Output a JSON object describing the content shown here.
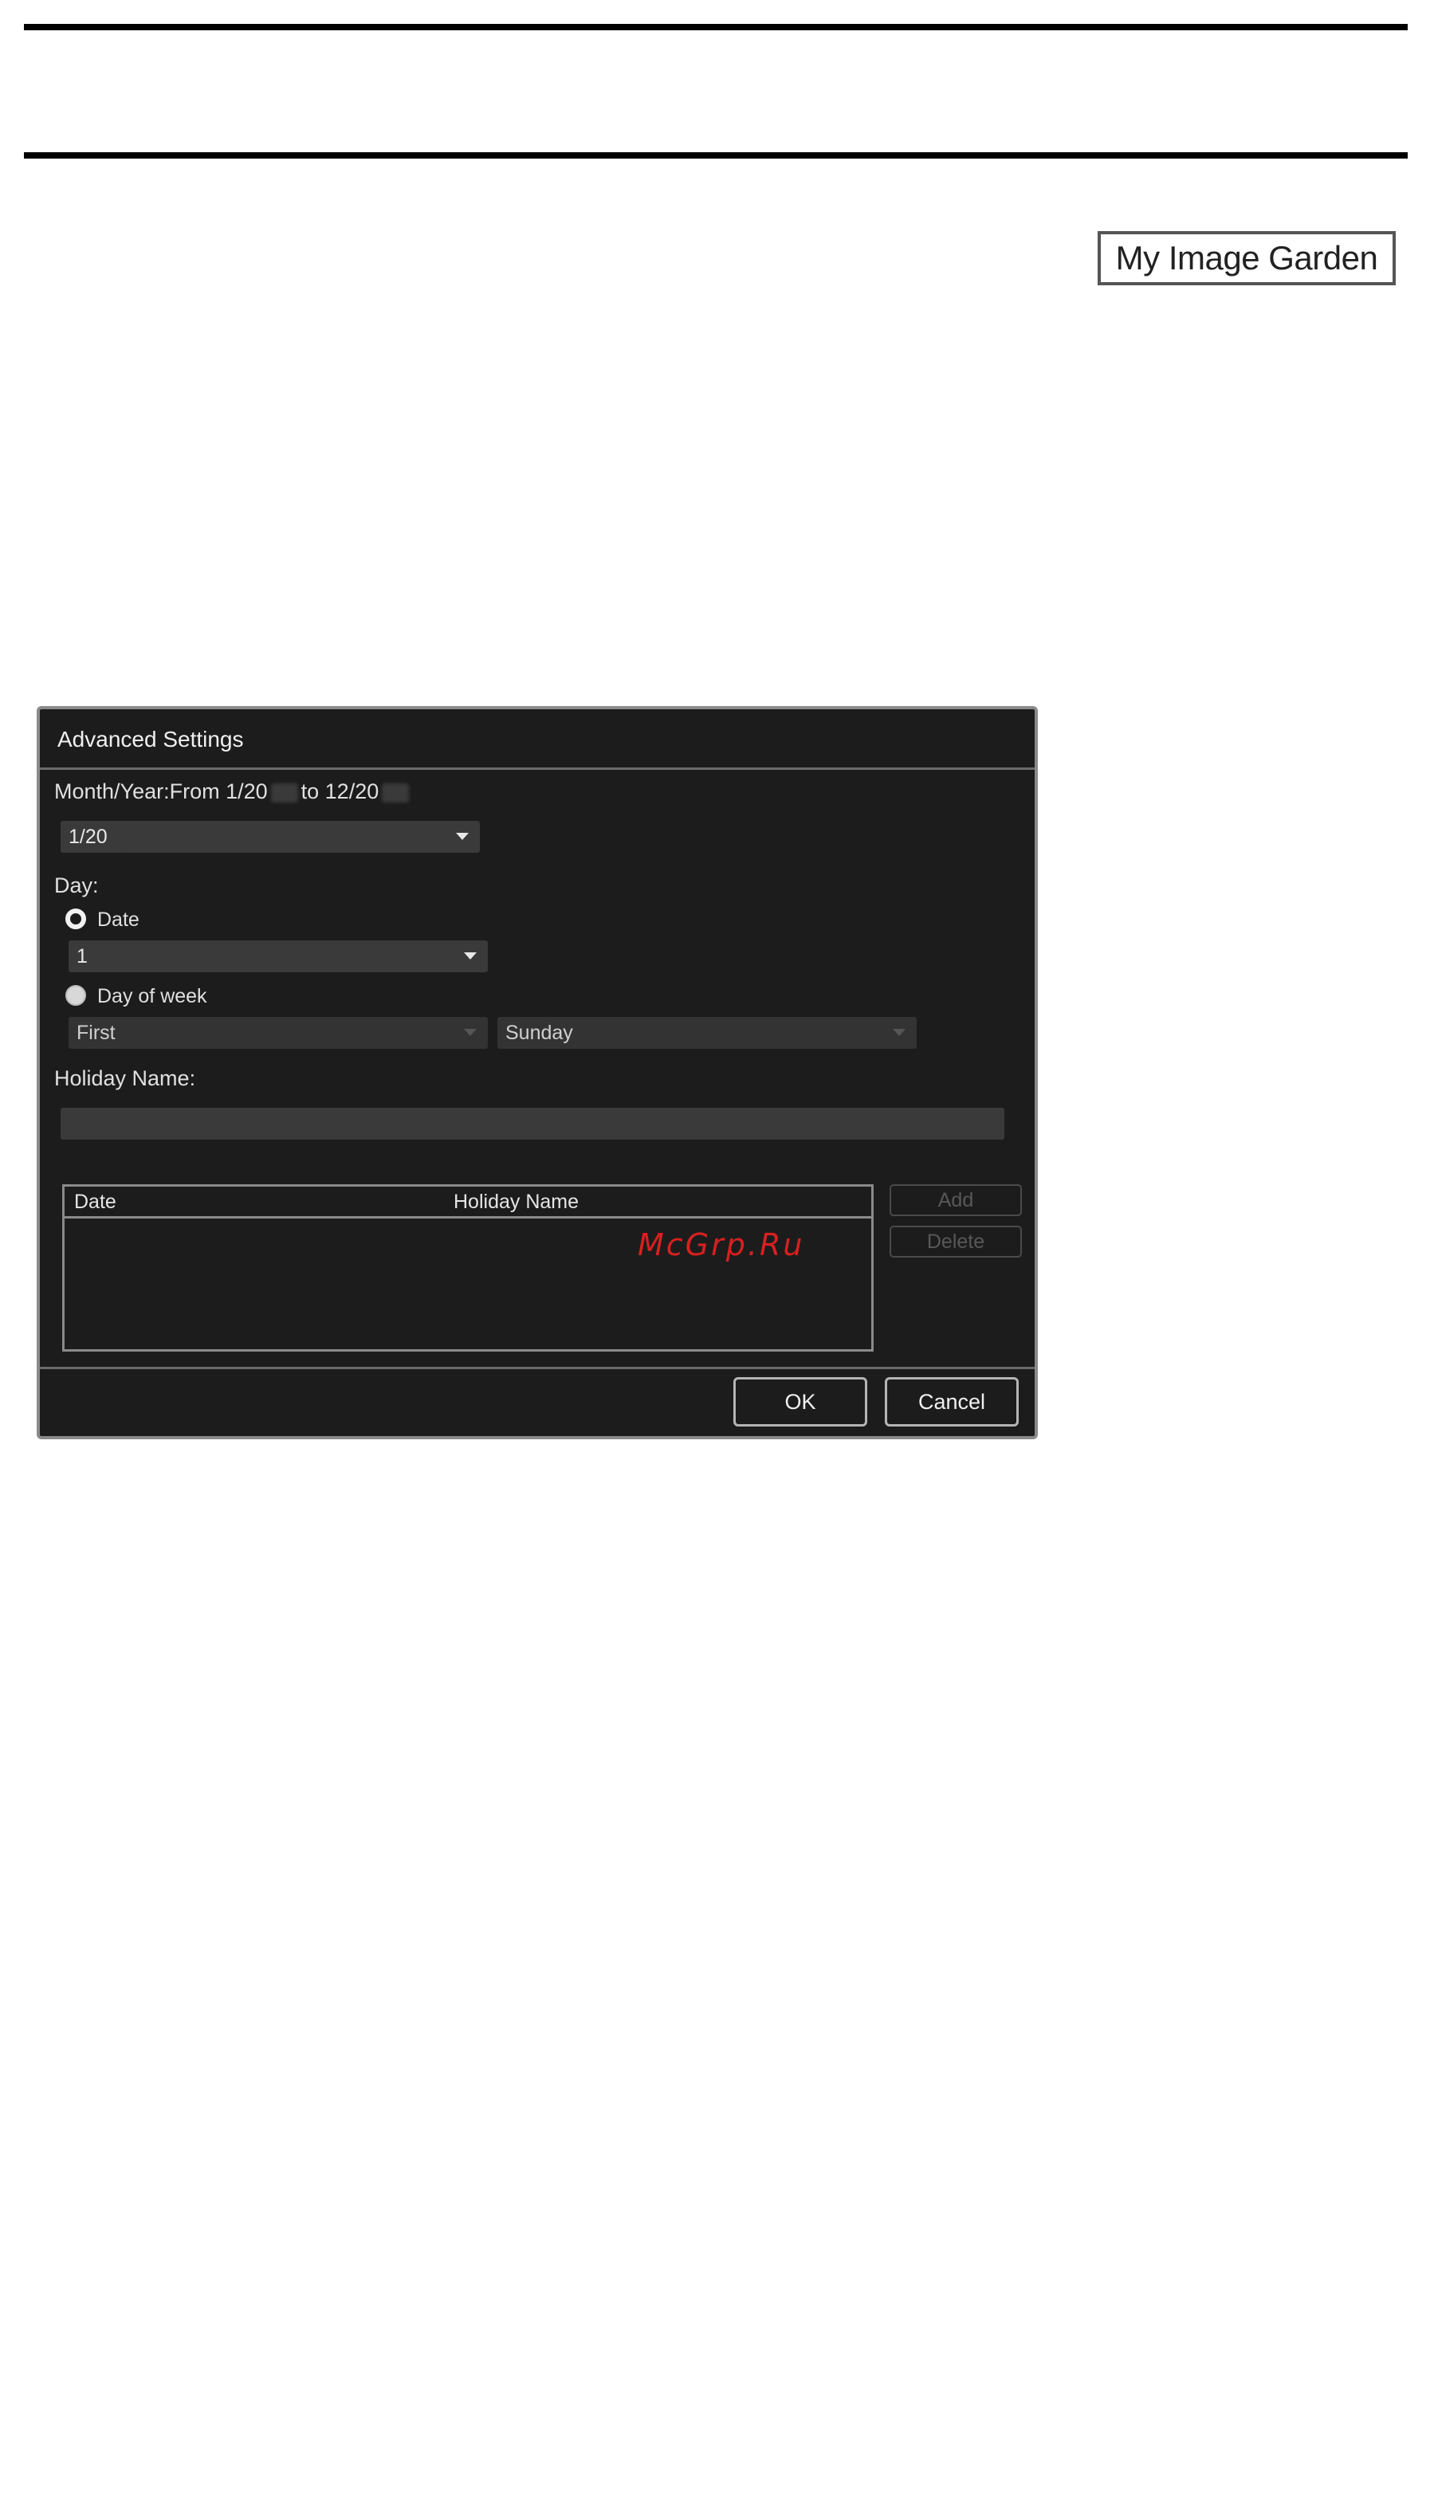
{
  "page": {
    "badge": "My Image Garden",
    "watermark": "McGrp.Ru"
  },
  "dialog": {
    "title": "Advanced Settings",
    "month_year_label_prefix": "Month/Year:From 1/20",
    "month_year_label_mid": "to 12/20",
    "month_select_value": "1/20",
    "day_label": "Day:",
    "date_radio_label": "Date",
    "date_select_value": "1",
    "dow_radio_label": "Day of week",
    "week_select_value": "First",
    "weekday_select_value": "Sunday",
    "holiday_name_label": "Holiday Name:",
    "holiday_name_value": "",
    "table": {
      "columns": [
        "Date",
        "Holiday Name"
      ],
      "rows": []
    },
    "add_label": "Add",
    "delete_label": "Delete",
    "ok_label": "OK",
    "cancel_label": "Cancel"
  }
}
